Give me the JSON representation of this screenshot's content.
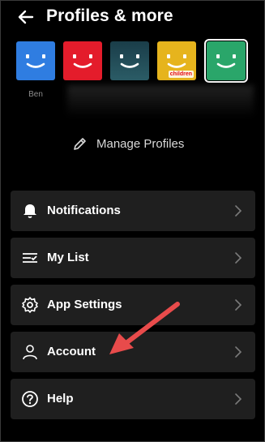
{
  "header": {
    "title": "Profiles & more",
    "back_icon": "arrow-left-icon"
  },
  "profiles": [
    {
      "name": "Ben",
      "color": "#2f7de1",
      "selected": false
    },
    {
      "name": "",
      "color": "#e41c2b",
      "selected": false
    },
    {
      "name": "",
      "color": "#1f4a57",
      "selected": false
    },
    {
      "name": "",
      "color": "#e6b41d",
      "kids_label": "children",
      "selected": false
    },
    {
      "name": "",
      "color": "#2aa66a",
      "selected": true
    }
  ],
  "manage": {
    "label": "Manage Profiles",
    "icon": "pencil-icon"
  },
  "menu": [
    {
      "label": "Notifications",
      "icon": "bell-icon"
    },
    {
      "label": "My List",
      "icon": "list-check-icon"
    },
    {
      "label": "App Settings",
      "icon": "gear-icon"
    },
    {
      "label": "Account",
      "icon": "person-icon"
    },
    {
      "label": "Help",
      "icon": "help-circle-icon"
    }
  ],
  "annotation": {
    "type": "arrow",
    "color": "#e84b4b",
    "points_to": "Account"
  }
}
